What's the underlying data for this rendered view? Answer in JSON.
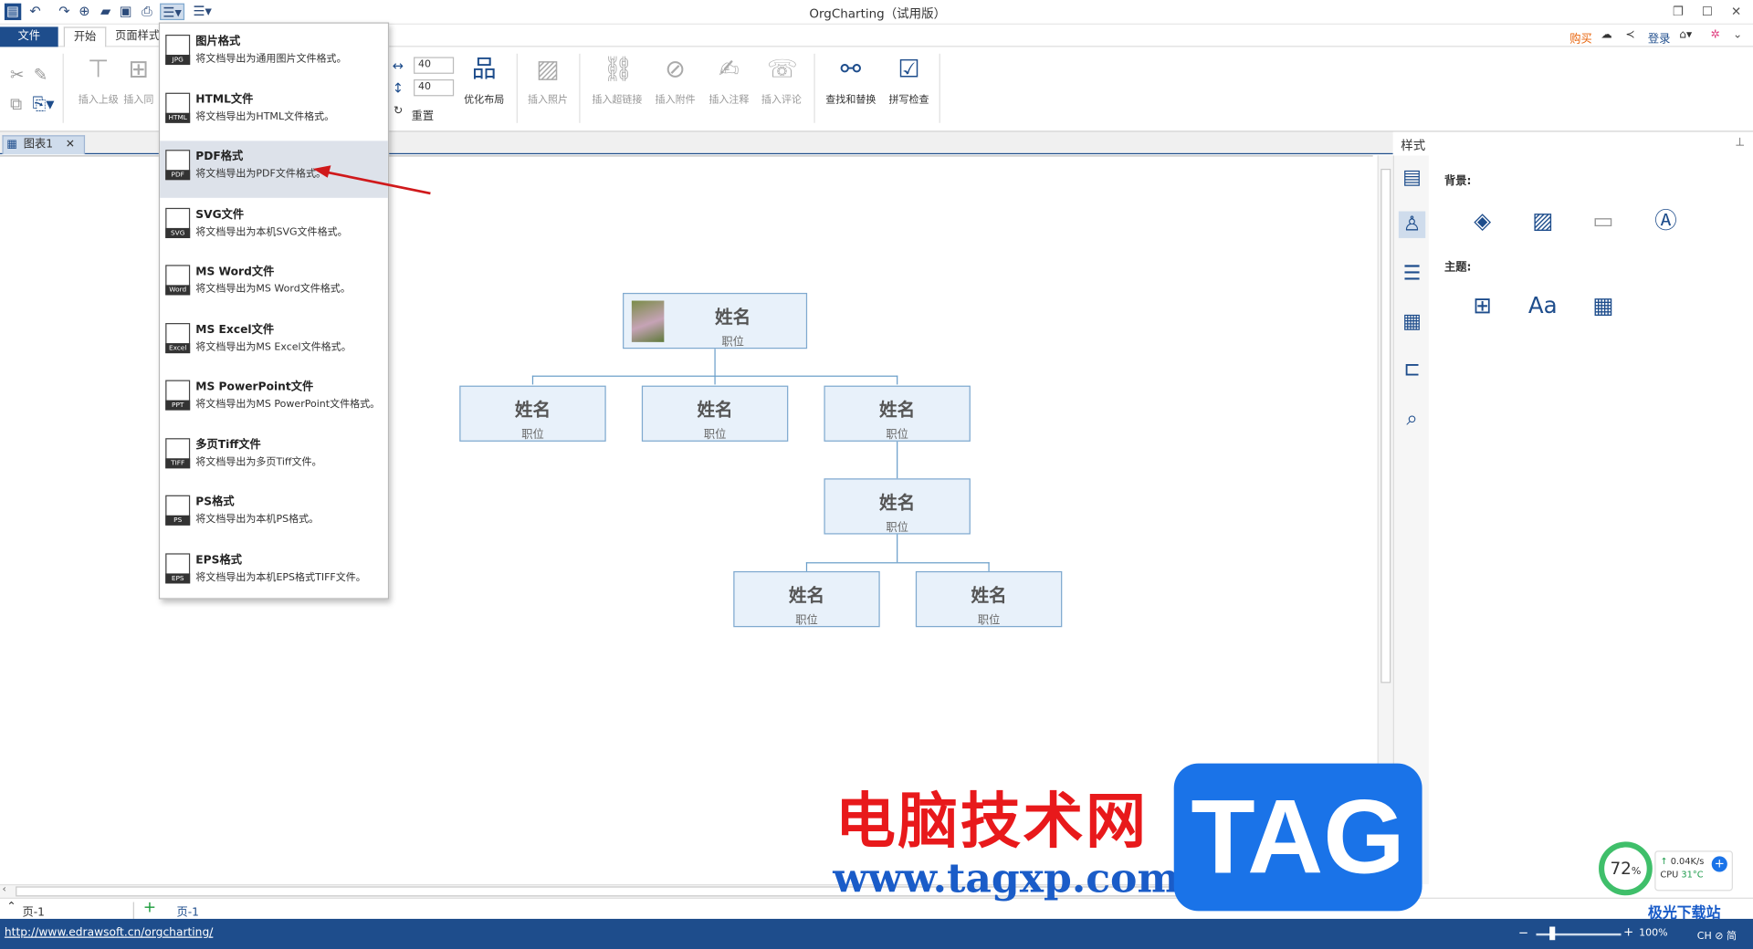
{
  "app": {
    "title": "OrgCharting（试用版）",
    "header_links": {
      "buy": "购买",
      "login": "登录"
    }
  },
  "menu_tabs": [
    "文件",
    "开始",
    "页面样式"
  ],
  "ribbon": {
    "spin_width": "40",
    "spin_height": "40",
    "reset_label": "重置",
    "buttons": [
      {
        "label": "插入上级",
        "icon": "insert-superior-icon",
        "enabled": false
      },
      {
        "label": "插入同",
        "icon": "insert-sibling-icon",
        "enabled": false
      },
      {
        "label": "优化布局",
        "icon": "optimize-layout-icon",
        "enabled": true
      },
      {
        "label": "插入照片",
        "icon": "insert-photo-icon",
        "enabled": false
      },
      {
        "label": "插入超链接",
        "icon": "link-icon",
        "enabled": false
      },
      {
        "label": "插入附件",
        "icon": "paperclip-icon",
        "enabled": false
      },
      {
        "label": "插入注释",
        "icon": "note-icon",
        "enabled": false
      },
      {
        "label": "插入评论",
        "icon": "comment-icon",
        "enabled": false
      },
      {
        "label": "查找和替换",
        "icon": "binoculars-icon",
        "enabled": true
      },
      {
        "label": "拼写检查",
        "icon": "spellcheck-icon",
        "enabled": true
      }
    ]
  },
  "doc_tab": {
    "label": "图表1"
  },
  "export_menu": {
    "highlighted_index": 2,
    "items": [
      {
        "title": "图片格式",
        "desc": "将文档导出为通用图片文件格式。",
        "icon_label": "JPG"
      },
      {
        "title": "HTML文件",
        "desc": "将文档导出为HTML文件格式。",
        "icon_label": "HTML"
      },
      {
        "title": "PDF格式",
        "desc": "将文档导出为PDF文件格式。",
        "icon_label": "PDF"
      },
      {
        "title": "SVG文件",
        "desc": "将文档导出为本机SVG文件格式。",
        "icon_label": "SVG"
      },
      {
        "title": "MS Word文件",
        "desc": "将文档导出为MS Word文件格式。",
        "icon_label": "Word"
      },
      {
        "title": "MS Excel文件",
        "desc": "将文档导出为MS Excel文件格式。",
        "icon_label": "Excel"
      },
      {
        "title": "MS PowerPoint文件",
        "desc": "将文档导出为MS PowerPoint文件格式。",
        "icon_label": "PPT"
      },
      {
        "title": "多页Tiff文件",
        "desc": "将文档导出为多页Tiff文件。",
        "icon_label": "TIFF"
      },
      {
        "title": "PS格式",
        "desc": "将文档导出为本机PS格式。",
        "icon_label": "PS"
      },
      {
        "title": "EPS格式",
        "desc": "将文档导出为本机EPS格式TIFF文件。",
        "icon_label": "EPS"
      }
    ]
  },
  "org_chart": {
    "nodes": [
      {
        "name": "姓名",
        "position": "职位",
        "has_photo": true
      },
      {
        "name": "姓名",
        "position": "职位"
      },
      {
        "name": "姓名",
        "position": "职位"
      },
      {
        "name": "姓名",
        "position": "职位"
      },
      {
        "name": "姓名",
        "position": "职位"
      },
      {
        "name": "姓名",
        "position": "职位"
      },
      {
        "name": "姓名",
        "position": "职位"
      }
    ]
  },
  "style_panel": {
    "title": "样式",
    "background_label": "背景:",
    "theme_label": "主题:",
    "theme_font_sample": "Aa"
  },
  "page_bar": {
    "page_selector": "页-1",
    "add": "+",
    "current_page": "页-1"
  },
  "status": {
    "url": "http://www.edrawsoft.cn/orgcharting/",
    "zoom": "100%",
    "ime": "CH ⊘ 简"
  },
  "system_widget": {
    "cpu_percent": "72",
    "net_speed": "0.04K/s",
    "cpu_temp_label": "CPU",
    "cpu_temp": "31°C"
  },
  "watermarks": {
    "cn": "电脑技术网",
    "url": "www.tagxp.com",
    "tag": "TAG",
    "corner": "极光下载站"
  },
  "colors": {
    "accent": "#1e4d8c",
    "node_fill": "#e8f1fa",
    "node_border": "#7fa9cf",
    "highlight": "#dde2ea",
    "arrow": "#d0191b",
    "watermark_red": "#e8191b",
    "watermark_blue": "#1a73e8"
  }
}
